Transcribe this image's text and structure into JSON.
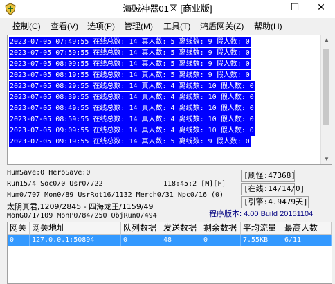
{
  "window": {
    "title": "海贼神器01区 [商业版]",
    "controls": {
      "minimize": "—",
      "maximize": "☐",
      "close": "✕"
    },
    "icon": "app-shield-icon"
  },
  "menu": [
    "控制(C)",
    "查看(V)",
    "选项(P)",
    "管理(M)",
    "工具(T)",
    "鸿盾网关(Z)",
    "帮助(H)"
  ],
  "log": [
    "2023-07-05 07:49:55 在线总数: 14 真人数: 5 离线数: 9 假人数: 0",
    "2023-07-05 07:59:55 在线总数: 14 真人数: 5 离线数: 9 假人数: 0",
    "2023-07-05 08:09:55 在线总数: 14 真人数: 5 离线数: 9 假人数: 0",
    "2023-07-05 08:19:55 在线总数: 14 真人数: 5 离线数: 9 假人数: 0",
    "2023-07-05 08:29:55 在线总数: 14 真人数: 4 离线数: 10 假人数: 0",
    "2023-07-05 08:39:55 在线总数: 14 真人数: 4 离线数: 10 假人数: 0",
    "2023-07-05 08:49:55 在线总数: 14 真人数: 4 离线数: 10 假人数: 0",
    "2023-07-05 08:59:55 在线总数: 14 真人数: 4 离线数: 10 假人数: 0",
    "2023-07-05 09:09:55 在线总数: 14 真人数: 4 离线数: 10 假人数: 0",
    "2023-07-05 09:19:55 在线总数: 14 真人数: 5 离线数: 9 假人数: 0"
  ],
  "status": {
    "save": "HumSave:0 HeroSave:0",
    "run": "Run15/4 Soc0/0 Usr0/722",
    "clock": "118:45:2 [M][F]",
    "mon": "Hum0/707 Mon0/89 UsrRot16/1132 Merch0/31 Npc0/16 (0)",
    "boss": "太阴真君,1209/2845 - 四海龙王/1159/49",
    "mongo": "MonG0/1/109 MonP0/84/250 ObjRun0/494",
    "brush": "[刷怪:47368]",
    "online": "[在线:14/14/0]",
    "engine": "[引擎:4.9479天]",
    "version": "程序版本: 4.00 Build 20151104"
  },
  "table": {
    "headers": [
      "网关",
      "网关地址",
      "队列数据",
      "发送数据",
      "剩余数据",
      "平均流量",
      "最高人数"
    ],
    "rows": [
      [
        "0",
        "127.0.0.1:50894",
        "0",
        "48",
        "0",
        "7.55KB",
        "6/11"
      ]
    ]
  },
  "colors": {
    "selection": "#0000ff",
    "row_highlight": "#3399ff",
    "version_text": "#000080"
  }
}
